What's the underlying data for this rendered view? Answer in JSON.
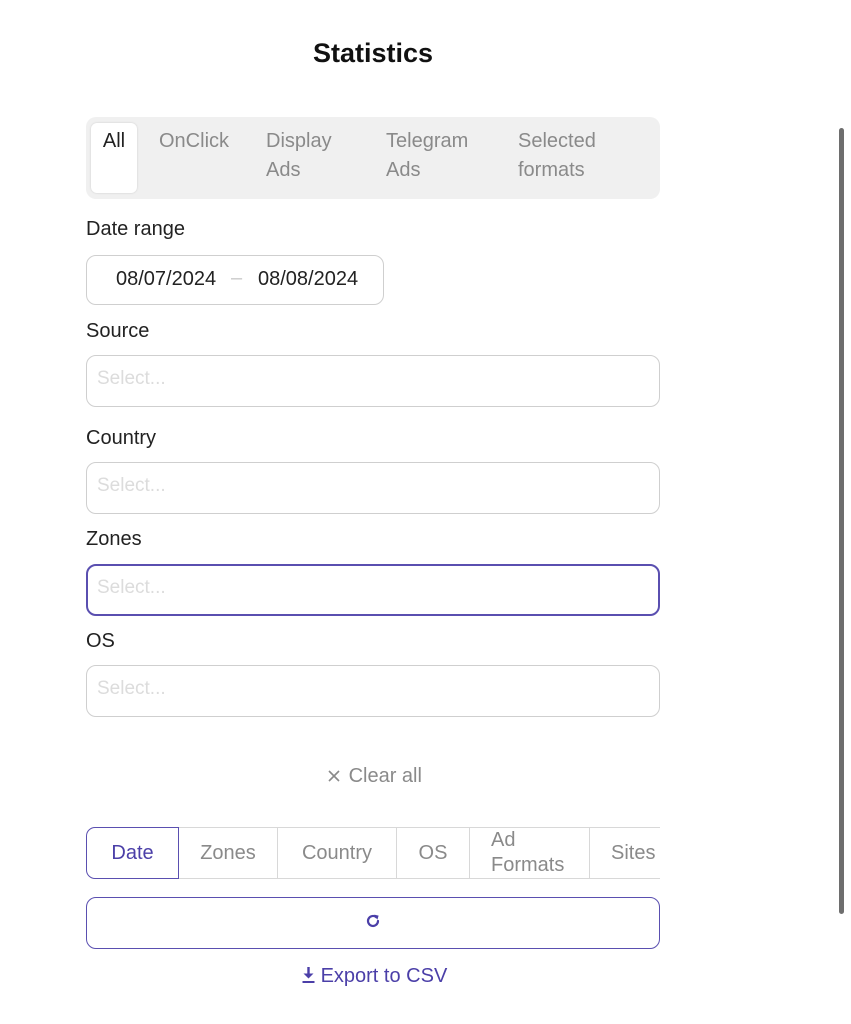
{
  "page": {
    "title": "Statistics"
  },
  "format_tabs": [
    {
      "label_line1": "All",
      "label_line2": ""
    },
    {
      "label_line1": "OnClick",
      "label_line2": ""
    },
    {
      "label_line1": "Display",
      "label_line2": "Ads"
    },
    {
      "label_line1": "Telegram",
      "label_line2": "Ads"
    },
    {
      "label_line1": "Selected",
      "label_line2": "formats"
    }
  ],
  "filters": {
    "date_range": {
      "label": "Date range",
      "start": "08/07/2024",
      "end": "08/08/2024",
      "separator": "–"
    },
    "source": {
      "label": "Source",
      "placeholder": "Select..."
    },
    "country": {
      "label": "Country",
      "placeholder": "Select..."
    },
    "zones": {
      "label": "Zones",
      "placeholder": "Select..."
    },
    "os": {
      "label": "OS",
      "placeholder": "Select..."
    }
  },
  "clear_all": {
    "icon": "close-icon",
    "label": "Clear all"
  },
  "group_tabs": [
    {
      "label_line1": "Date",
      "label_line2": ""
    },
    {
      "label_line1": "Zones",
      "label_line2": ""
    },
    {
      "label_line1": "Country",
      "label_line2": ""
    },
    {
      "label_line1": "OS",
      "label_line2": ""
    },
    {
      "label_line1": "Ad",
      "label_line2": "Formats"
    },
    {
      "label_line1": "Sites",
      "label_line2": ""
    }
  ],
  "refresh_button": {
    "icon": "refresh-icon"
  },
  "export": {
    "icon": "download-icon",
    "label": "Export to CSV"
  },
  "colors": {
    "accent": "#5a4fb0",
    "muted_text": "#8a8a8a",
    "tab_bg": "#f0f0f0"
  }
}
